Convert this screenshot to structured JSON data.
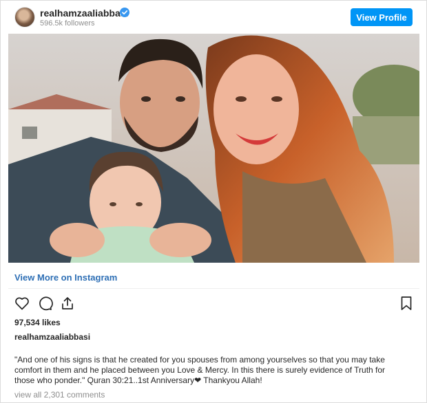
{
  "header": {
    "username": "realhamzaaliabbasi",
    "followers": "596.5k followers",
    "view_profile_label": "View Profile",
    "verified_icon": "verified-badge-icon"
  },
  "post": {
    "photo_description_icon": "photo",
    "view_more_label": "View More on Instagram",
    "actions": [
      "heart-icon",
      "comment-icon",
      "share-icon",
      "bookmark-icon"
    ],
    "likes": "97,534 likes",
    "caption_username": "realhamzaaliabbasi",
    "caption": "\"And one of his signs is that he created for you spouses from among yourselves so that you may take comfort in them and he placed between you Love & Mercy. In this there is surely evidence of Truth for those who ponder.\" Quran 30:21..1st Anniversary❤ Thankyou Allah!",
    "comments_link": "view all 2,301 comments"
  },
  "colors": {
    "button_blue": "#0095f6",
    "link_blue": "#2e6fb5",
    "text": "#262626",
    "muted": "#8e8e8e"
  }
}
